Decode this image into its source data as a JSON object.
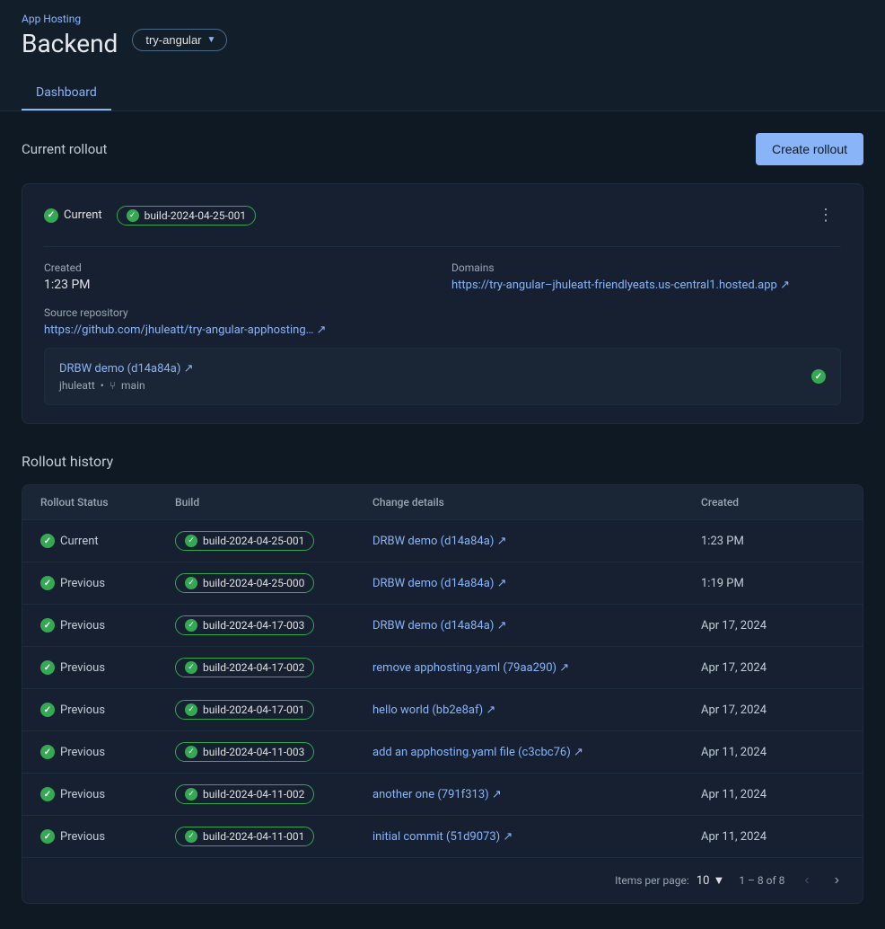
{
  "app": {
    "hosting_label": "App Hosting",
    "backend_title": "Backend",
    "branch": "try-angular"
  },
  "tabs": [
    {
      "id": "dashboard",
      "label": "Dashboard",
      "active": true
    }
  ],
  "current_rollout": {
    "section_title": "Current rollout",
    "create_btn": "Create rollout",
    "status": "Current",
    "build_id": "build-2024-04-25-001",
    "more_icon": "⋮",
    "created_label": "Created",
    "created_value": "1:23 PM",
    "source_repo_label": "Source repository",
    "source_repo_url": "https://github.com/jhuleatt/try-angular-apphosting",
    "source_repo_display": "https://github.com/jhuleatt/try-angular-apphosting… ↗",
    "domains_label": "Domains",
    "domains_url": "https://try-angular–jhuleatt-friendlyeats.us-central1.hosted.app",
    "domains_display": "https://try-angular–jhuleatt-friendlyeats.us-central1.hosted.app ↗",
    "commit_title": "DRBW demo (d14a84a) ↗",
    "commit_user": "jhuleatt",
    "commit_branch": "main"
  },
  "rollout_history": {
    "title": "Rollout history",
    "columns": [
      "Rollout Status",
      "Build",
      "Change details",
      "Created"
    ],
    "rows": [
      {
        "status": "Current",
        "build": "build-2024-04-25-001",
        "change": "DRBW demo (d14a84a)",
        "change_icon": "↗",
        "created": "1:23 PM"
      },
      {
        "status": "Previous",
        "build": "build-2024-04-25-000",
        "change": "DRBW demo (d14a84a)",
        "change_icon": "↗",
        "created": "1:19 PM"
      },
      {
        "status": "Previous",
        "build": "build-2024-04-17-003",
        "change": "DRBW demo (d14a84a)",
        "change_icon": "↗",
        "created": "Apr 17, 2024"
      },
      {
        "status": "Previous",
        "build": "build-2024-04-17-002",
        "change": "remove apphosting.yaml (79aa290)",
        "change_icon": "↗",
        "created": "Apr 17, 2024"
      },
      {
        "status": "Previous",
        "build": "build-2024-04-17-001",
        "change": "hello world (bb2e8af)",
        "change_icon": "↗",
        "created": "Apr 17, 2024"
      },
      {
        "status": "Previous",
        "build": "build-2024-04-11-003",
        "change": "add an apphosting.yaml file (c3cbc76)",
        "change_icon": "↗",
        "created": "Apr 11, 2024"
      },
      {
        "status": "Previous",
        "build": "build-2024-04-11-002",
        "change": "another one (791f313)",
        "change_icon": "↗",
        "created": "Apr 11, 2024"
      },
      {
        "status": "Previous",
        "build": "build-2024-04-11-001",
        "change": "initial commit (51d9073)",
        "change_icon": "↗",
        "created": "Apr 11, 2024"
      }
    ],
    "items_per_page_label": "Items per page:",
    "items_per_page_value": "10",
    "page_range": "1 – 8 of 8"
  }
}
